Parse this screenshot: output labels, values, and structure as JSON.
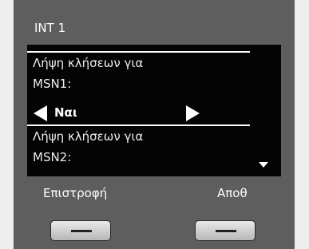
{
  "header": {
    "title": "INT 1"
  },
  "settings": {
    "msn1_label_line1": "Λήψη κλήσεων για",
    "msn1_label_line2": "MSN1:",
    "msn1_value": "Ναι",
    "msn2_label_line1": "Λήψη κλήσεων για",
    "msn2_label_line2": "MSN2:"
  },
  "softkeys": {
    "left_label": "Επιστροφή",
    "right_label": "Αποθ"
  },
  "icons": {
    "value_prev": "triangle-left-icon",
    "value_next": "triangle-right-icon",
    "scroll_more": "triangle-down-icon"
  }
}
